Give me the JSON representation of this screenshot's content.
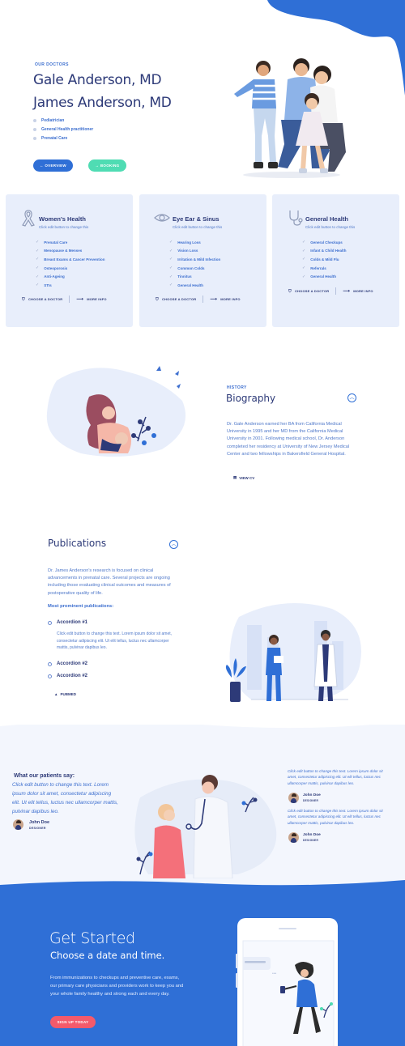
{
  "hero": {
    "eyebrow": "OUR DOCTORS",
    "name_1": "Gale Anderson, MD",
    "name_2": "James Anderson, MD",
    "specialties": [
      "Pediatrician",
      "General Health practitioner",
      "Prenatal Care"
    ],
    "overview_btn": "← OVERVIEW",
    "booking_btn": "→ BOOKING"
  },
  "cards": [
    {
      "title": "Women's Health",
      "subtitle": "Click edit button to change this",
      "icon": "ribbon-icon",
      "items": [
        "Prenatal Care",
        "Menopause & Menses",
        "Breast Exams & Cancer Prevention",
        "Osteoporosis",
        "Anti-Ageing",
        "STIs"
      ],
      "choose": "CHOOSE A DOCTOR",
      "more": "MORE INFO"
    },
    {
      "title": "Eye Ear & Sinus",
      "subtitle": "Click edit button to change this",
      "icon": "eye-icon",
      "items": [
        "Hearing Loss",
        "Vision Loss",
        "Irritation & Mild Infection",
        "Common Colds",
        "Tinnitus",
        "General Health"
      ],
      "choose": "CHOOSE A DOCTOR",
      "more": "MORE INFO"
    },
    {
      "title": "General Health",
      "subtitle": "Click edit button to change this",
      "icon": "stethoscope-icon",
      "items": [
        "General Checkups",
        "Infant & Child Health",
        "Colds & Mild Flu",
        "Referrals",
        "General Health"
      ],
      "choose": "CHOOSE A DOCTOR",
      "more": "MORE INFO"
    }
  ],
  "biography": {
    "eyebrow": "HISTORY",
    "title": "Biography",
    "text": "Dr. Gale Anderson earned her BA from California Medical University in 1995 and her MD from the California Medical University in 2001. Following medical school, Dr. Anderson completed her residency  at University of New Jersey Medical Center and two fellowships in Bakersfield General Hospital.",
    "cv_link": "VIEW CV"
  },
  "publications": {
    "title": "Publications",
    "text": "Dr. James Anderson's research is focused on clinical advancements in prenatal care. Several projects are ongoing including those evaluating clinical outcomes and measures of postoperative quality of life.",
    "heading": "Most prominent publications:",
    "accordions": [
      {
        "title": "Accordion #1",
        "body": "Click edit button to change this text. Lorem ipsum dolor sit amet, consectetur adipiscing elit. Ut elit tellus, luctus nec ullamcorper mattis, pulvinar dapibus leo."
      },
      {
        "title": "Accordion #2",
        "body": ""
      },
      {
        "title": "Accordion #2",
        "body": ""
      }
    ],
    "pubmed": "PUBMED"
  },
  "testimonials": {
    "heading": "What our patients say:",
    "main_quote": "Click edit button to change this text. Lorem ipsum dolor sit amet, consectetur adipiscing elit. Ut elit tellus, luctus nec ullamcorper mattis, pulvinar dapibus leo.",
    "main_author": "John Doe",
    "main_role": "DESIGNER",
    "side": [
      {
        "quote": "Click edit button to change this text. Lorem ipsum dolor sit amet, consectetur adipiscing elit. Ut elit tellus, luctus nec ullamcorper mattis, pulvinar dapibus leo.",
        "author": "John Doe",
        "role": "DESIGNER"
      },
      {
        "quote": "Click edit button to change this text. Lorem ipsum dolor sit amet, consectetur adipiscing elit. Ut elit tellus, luctus nec ullamcorper mattis, pulvinar dapibus leo.",
        "author": "John Doe",
        "role": "DESIGNER"
      }
    ]
  },
  "cta": {
    "title": "Get Started",
    "subtitle": "Choose a date and time.",
    "text": "From immunizations to checkups and  preventive care, exams, our primary care physicians and providers work to keep you and your whole family healthy and strong each and every day.",
    "button": "SIGN UP TODAY"
  },
  "colors": {
    "primary": "#2f6fd6",
    "navy": "#2d3a78",
    "mint": "#4fdcb3",
    "coral": "#f45a6b",
    "card_bg": "#e8eefb"
  }
}
